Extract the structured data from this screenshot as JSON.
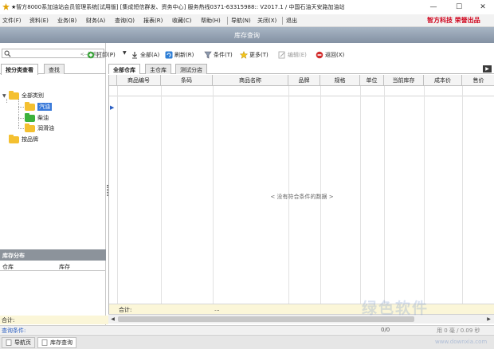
{
  "window": {
    "title": "★智方8000系加油站会员管理系统[试用版] [集成短信群发、资务中心] 服务热线0371-63315988:: V2017.1 / 中国石油天安路加油站",
    "minimize": "—",
    "maximize": "☐",
    "close": "✕"
  },
  "menu": {
    "items": [
      "文件(F)",
      "资料(E)",
      "业务(B)",
      "财务(A)",
      "查询(Q)",
      "报表(R)",
      "收藏(C)",
      "帮助(H)",
      "导航(N)",
      "关闭(X)",
      "退出"
    ],
    "brand": "智方科技 荣誉出品"
  },
  "page_header": {
    "title": "库存查询"
  },
  "left": {
    "search_placeholder": "<--搜索>",
    "tabs": [
      "按分类查看",
      "查找"
    ],
    "tree": {
      "root": "全部类别",
      "children": [
        "汽油",
        "柴油",
        "润滑油"
      ],
      "other": "按品牌"
    },
    "sub_panel": {
      "title": "库存分布",
      "col_warehouse": "仓库",
      "col_stock": "库存"
    }
  },
  "toolbar": {
    "print": "打印(P)",
    "print_dropdown": "▼",
    "all": "全部(A)",
    "refresh": "刷新(R)",
    "condition": "条件(T)",
    "more": "更多(T)",
    "edit": "编辑(E)",
    "back": "返回(X)"
  },
  "right": {
    "tabs": [
      "全部仓库",
      "主仓库",
      "测试分店"
    ],
    "tab_scroll": "▶",
    "columns": [
      "商品编号",
      "条码",
      "商品名称",
      "品牌",
      "规格",
      "单位",
      "当前库存",
      "成本价",
      "售价"
    ],
    "empty_message": "< 没有符合条件的数据 >",
    "sum_label": "合计:",
    "sum_value": "..."
  },
  "status": {
    "total_label": "合计:",
    "filter_label": "查询条件:",
    "record_count": "0/0",
    "timing": "用 0 毫 / 0.09 秒"
  },
  "bottom_tabs": [
    "导航页",
    "库存查询"
  ],
  "watermark": {
    "text": "绿色软件",
    "sub": "www.downxia.com"
  }
}
